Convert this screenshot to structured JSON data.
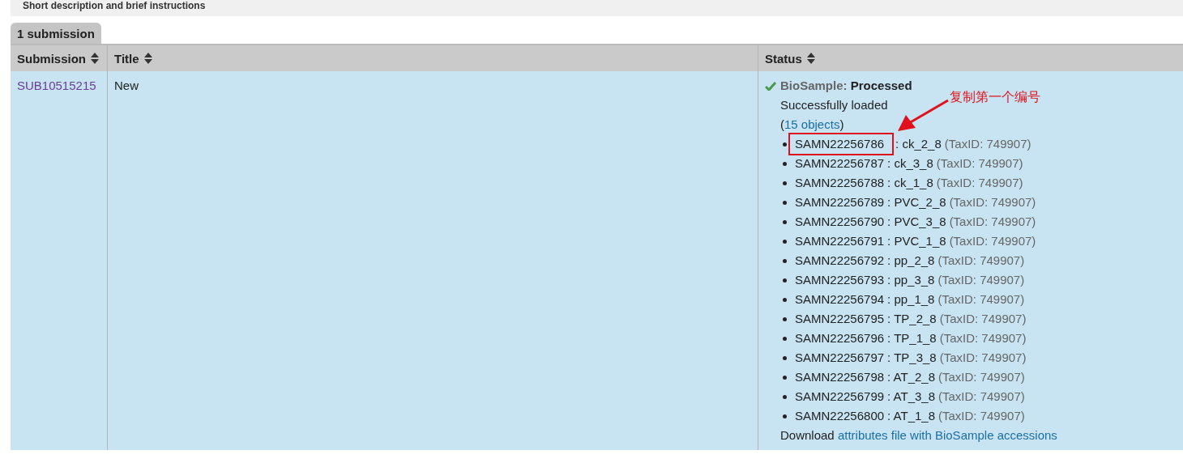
{
  "banner": {
    "text": "Short description and brief instructions"
  },
  "tab": {
    "label": "1 submission",
    "selected": true
  },
  "table": {
    "columns": [
      {
        "label": "Submission"
      },
      {
        "label": "Title"
      },
      {
        "label": "Status"
      }
    ],
    "rows": [
      {
        "submission": "SUB10515215",
        "title": "New",
        "status": {
          "database": "BioSample:",
          "state": "Processed",
          "message": "Successfully loaded",
          "objects_open": "(",
          "objects_link": "15 objects",
          "objects_close": ")",
          "items": [
            {
              "accession": "SAMN22256786",
              "name": ": ck_2_8",
              "taxid": "(TaxID: 749907)",
              "highlighted": true
            },
            {
              "accession": "SAMN22256787",
              "name": ": ck_3_8",
              "taxid": "(TaxID: 749907)",
              "highlighted": false
            },
            {
              "accession": "SAMN22256788",
              "name": ": ck_1_8",
              "taxid": "(TaxID: 749907)",
              "highlighted": false
            },
            {
              "accession": "SAMN22256789",
              "name": ": PVC_2_8",
              "taxid": "(TaxID: 749907)",
              "highlighted": false
            },
            {
              "accession": "SAMN22256790",
              "name": ": PVC_3_8",
              "taxid": "(TaxID: 749907)",
              "highlighted": false
            },
            {
              "accession": "SAMN22256791",
              "name": ": PVC_1_8",
              "taxid": "(TaxID: 749907)",
              "highlighted": false
            },
            {
              "accession": "SAMN22256792",
              "name": ": pp_2_8",
              "taxid": "(TaxID: 749907)",
              "highlighted": false
            },
            {
              "accession": "SAMN22256793",
              "name": ": pp_3_8",
              "taxid": "(TaxID: 749907)",
              "highlighted": false
            },
            {
              "accession": "SAMN22256794",
              "name": ": pp_1_8",
              "taxid": "(TaxID: 749907)",
              "highlighted": false
            },
            {
              "accession": "SAMN22256795",
              "name": ": TP_2_8",
              "taxid": "(TaxID: 749907)",
              "highlighted": false
            },
            {
              "accession": "SAMN22256796",
              "name": ": TP_1_8",
              "taxid": "(TaxID: 749907)",
              "highlighted": false
            },
            {
              "accession": "SAMN22256797",
              "name": ": TP_3_8",
              "taxid": "(TaxID: 749907)",
              "highlighted": false
            },
            {
              "accession": "SAMN22256798",
              "name": ": AT_2_8",
              "taxid": "(TaxID: 749907)",
              "highlighted": false
            },
            {
              "accession": "SAMN22256799",
              "name": ": AT_3_8",
              "taxid": "(TaxID: 749907)",
              "highlighted": false
            },
            {
              "accession": "SAMN22256800",
              "name": ": AT_1_8",
              "taxid": "(TaxID: 749907)",
              "highlighted": false
            }
          ],
          "download_text": "Download",
          "download_link": "attributes file with BioSample accessions"
        }
      }
    ]
  },
  "annotation": {
    "note": "复制第一个编号"
  }
}
